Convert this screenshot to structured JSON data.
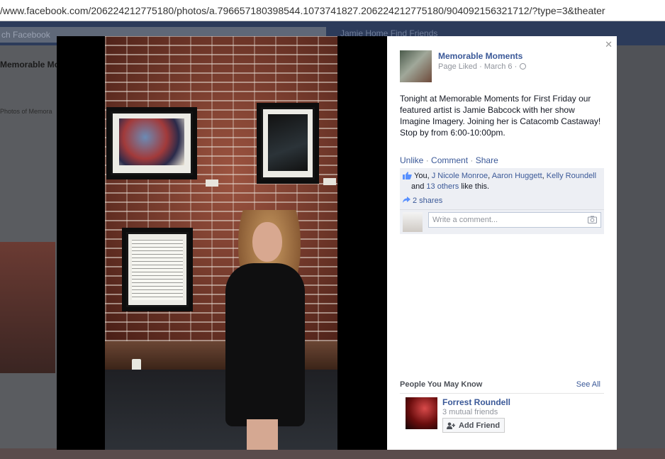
{
  "browser": {
    "url": "/www.facebook.com/206224212775180/photos/a.796657180398544.1073741827.206224212775180/904092156321712/?type=3&theater"
  },
  "background": {
    "search_placeholder": "ch Facebook",
    "nav_text": "Jamie   Home   Find Friends",
    "left_title": "Memorable Mo",
    "left_sub": "Photos of Memora"
  },
  "post": {
    "page_name": "Memorable Moments",
    "meta": "Page Liked · March 6 ·",
    "body": "Tonight at Memorable Moments for First Friday our featured artist is Jamie Babcock with her show Imagine Imagery. Joining her is Catacomb Castaway! Stop by from 6:00-10:00pm.",
    "actions": {
      "unlike": "Unlike",
      "comment": "Comment",
      "share": "Share",
      "separator": "·"
    },
    "likes": {
      "prefix": "You, ",
      "names": [
        "J Nicole Monroe",
        "Aaron Huggett",
        "Kelly Roundell"
      ],
      "sep1": ", ",
      "sep2": ", ",
      "and": " and ",
      "others": "13 others",
      "suffix": " like this."
    },
    "shares": "2 shares",
    "comment_placeholder": "Write a comment..."
  },
  "pymk": {
    "title": "People You May Know",
    "see_all": "See All",
    "person": {
      "name": "Forrest Roundell",
      "mutual": "3 mutual friends",
      "add_label": "Add Friend"
    }
  },
  "colors": {
    "link": "#3b5998",
    "muted": "#90949c",
    "ufi_bg": "#edeff4"
  },
  "icons": {
    "close": "close-icon",
    "like": "thumbs-up-icon",
    "share": "share-arrow-icon",
    "camera": "camera-icon",
    "add_friend": "add-friend-icon",
    "globe": "globe-icon"
  }
}
